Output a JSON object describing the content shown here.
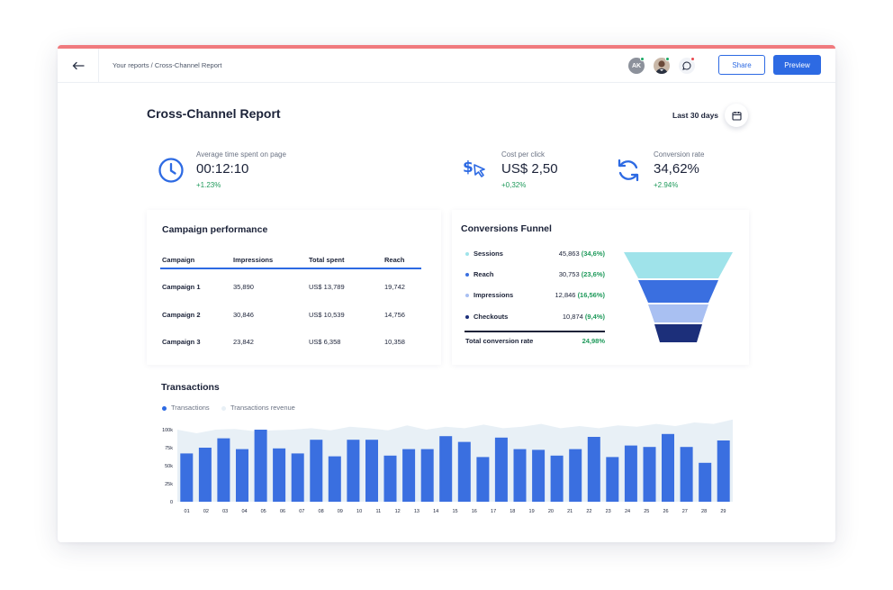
{
  "colors": {
    "accent_bar": "#f07a7e",
    "primary": "#2d6ae3",
    "positive": "#1f9a5b",
    "bar": "#3a6fe0",
    "area": "#e8f0f6"
  },
  "topbar": {
    "back_icon": "arrow-left-icon",
    "breadcrumb": "Your reports / Cross-Channel Report",
    "avatar_initials": "AK",
    "share_label": "Share",
    "preview_label": "Preview"
  },
  "header": {
    "title": "Cross-Channel Report",
    "date_range": "Last 30 days"
  },
  "kpis": [
    {
      "icon": "clock-icon",
      "label": "Average time spent on page",
      "value": "00:12:10",
      "delta": "+1.23%"
    },
    {
      "icon": "dollar-cursor-icon",
      "label": "Cost per click",
      "value": "US$ 2,50",
      "delta": "+0,32%"
    },
    {
      "icon": "refresh-icon",
      "label": "Conversion rate",
      "value": "34,62%",
      "delta": "+2.94%"
    }
  ],
  "campaign_performance": {
    "title": "Campaign performance",
    "columns": [
      "Campaign",
      "Impressions",
      "Total spent",
      "Reach"
    ],
    "rows": [
      [
        "Campaign 1",
        "35,890",
        "US$ 13,789",
        "19,742"
      ],
      [
        "Campaign 2",
        "30,846",
        "US$ 10,539",
        "14,756"
      ],
      [
        "Campaign 3",
        "23,842",
        "US$ 6,358",
        "10,358"
      ]
    ]
  },
  "funnel": {
    "title": "Conversions Funnel",
    "stages": [
      {
        "name": "Sessions",
        "value": "45,863",
        "pct": "(34,6%)",
        "color": "#9fe3ea"
      },
      {
        "name": "Reach",
        "value": "30,753",
        "pct": "(23,6%)",
        "color": "#3a6fe0"
      },
      {
        "name": "Impressions",
        "value": "12,846",
        "pct": "(16,56%)",
        "color": "#a9c0f2"
      },
      {
        "name": "Checkouts",
        "value": "10,874",
        "pct": "(9,4%)",
        "color": "#1c2f7a"
      }
    ],
    "total_label": "Total conversion rate",
    "total_value": "24,98%"
  },
  "transactions": {
    "title": "Transactions",
    "legend": [
      "Transactions",
      "Transactions revenue"
    ]
  },
  "chart_data": {
    "type": "bar",
    "title": "Transactions",
    "xlabel": "",
    "ylabel": "",
    "ylim": [
      0,
      100000
    ],
    "yticks": [
      "0",
      "25k",
      "50k",
      "75k",
      "100k"
    ],
    "categories": [
      "01",
      "02",
      "03",
      "04",
      "05",
      "06",
      "07",
      "08",
      "09",
      "10",
      "11",
      "12",
      "13",
      "14",
      "15",
      "16",
      "17",
      "18",
      "19",
      "20",
      "21",
      "22",
      "23",
      "24",
      "25",
      "26",
      "27",
      "28",
      "29"
    ],
    "series": [
      {
        "name": "Transactions",
        "type": "bar",
        "values": [
          67000,
          75000,
          88000,
          73000,
          100000,
          74000,
          67000,
          86000,
          63000,
          86000,
          86000,
          64000,
          73000,
          73000,
          91000,
          83000,
          62000,
          89000,
          73000,
          72000,
          64000,
          73000,
          90000,
          62000,
          78000,
          76000,
          94000,
          76000,
          54000,
          85000
        ]
      },
      {
        "name": "Transactions revenue",
        "type": "area",
        "values": [
          100000,
          95000,
          100000,
          101000,
          98000,
          99000,
          100000,
          102000,
          99000,
          104000,
          102000,
          99000,
          106000,
          100000,
          104000,
          102000,
          107000,
          102000,
          104000,
          108000,
          102000,
          105000,
          102000,
          106000,
          104000,
          108000,
          105000,
          110000,
          108000,
          114000
        ]
      }
    ]
  }
}
